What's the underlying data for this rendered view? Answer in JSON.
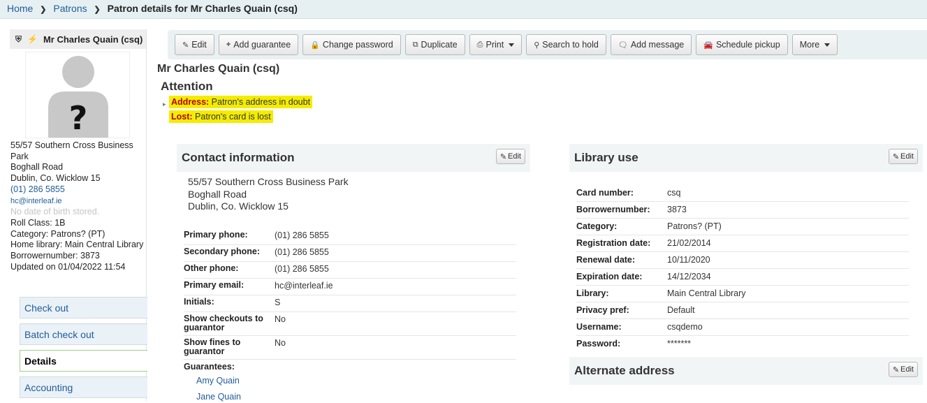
{
  "breadcrumb": {
    "home": "Home",
    "patrons": "Patrons",
    "current": "Patron details for Mr Charles Quain (csq)"
  },
  "sidebar": {
    "patron_name": "Mr Charles Quain (csq)",
    "icons": [
      "shield-icon",
      "flash-icon"
    ],
    "info": {
      "address1": "55/57 Southern Cross Business Park",
      "address2": "Boghall Road",
      "address3": "Dublin, Co. Wicklow 15",
      "phone": "(01) 286 5855",
      "email": "hc@interleaf.ie",
      "dob": "No date of birth stored.",
      "roll_class": "Roll Class: 1B",
      "category": "Category: Patrons? (PT)",
      "home_library": "Home library: Main Central Library",
      "borrowernumber": "Borrowernumber: 3873",
      "updated": "Updated on 01/04/2022 11:54"
    },
    "tabs": [
      {
        "label": "Check out"
      },
      {
        "label": "Batch check out"
      },
      {
        "label": "Details"
      },
      {
        "label": "Accounting"
      }
    ]
  },
  "toolbar": {
    "buttons": [
      {
        "label": "Edit",
        "icon": "pencil-icon"
      },
      {
        "label": "Add guarantee",
        "icon": "plus-icon"
      },
      {
        "label": "Change password",
        "icon": "lock-icon"
      },
      {
        "label": "Duplicate",
        "icon": "copy-icon"
      },
      {
        "label": "Print",
        "icon": "print-icon"
      },
      {
        "label": "Search to hold",
        "icon": "search-icon"
      },
      {
        "label": "Add message",
        "icon": "comment-icon"
      },
      {
        "label": "Schedule pickup",
        "icon": "car-icon"
      },
      {
        "label": "More"
      }
    ]
  },
  "main": {
    "patron_title": "Mr Charles Quain (csq)",
    "attention_title": "Attention",
    "alerts": [
      {
        "key": "Address:",
        "text": "Patron's address in doubt"
      },
      {
        "key": "Lost:",
        "text": "Patron's card is lost"
      }
    ],
    "alert_color": "#f4ec00"
  },
  "contact": {
    "title": "Contact information",
    "edit_label": "Edit",
    "address": [
      "55/57 Southern Cross Business Park",
      "Boghall Road",
      "Dublin, Co. Wicklow 15"
    ],
    "fields": [
      {
        "label": "Primary phone:",
        "value": "(01) 286 5855"
      },
      {
        "label": "Secondary phone:",
        "value": "(01) 286 5855"
      },
      {
        "label": "Other phone:",
        "value": "(01) 286 5855"
      },
      {
        "label": "Primary email:",
        "value": "hc@interleaf.ie"
      },
      {
        "label": "Initials:",
        "value": "S"
      },
      {
        "label": "Show checkouts to guarantor",
        "value": "No"
      },
      {
        "label": "Show fines to guarantor",
        "value": "No"
      }
    ],
    "guarantees_label": "Guarantees:",
    "guarantees": [
      "Amy Quain",
      "Jane Quain"
    ]
  },
  "library_use": {
    "title": "Library use",
    "edit_label": "Edit",
    "fields": [
      {
        "label": "Card number:",
        "value": "csq"
      },
      {
        "label": "Borrowernumber:",
        "value": "3873"
      },
      {
        "label": "Category:",
        "value": "Patrons? (PT)"
      },
      {
        "label": "Registration date:",
        "value": "21/02/2014"
      },
      {
        "label": "Renewal date:",
        "value": "10/11/2020"
      },
      {
        "label": "Expiration date:",
        "value": "14/12/2034"
      },
      {
        "label": "Library:",
        "value": "Main Central Library"
      },
      {
        "label": "Privacy pref:",
        "value": "Default"
      },
      {
        "label": "Username:",
        "value": "csqdemo"
      },
      {
        "label": "Password:",
        "value": "*******"
      }
    ]
  },
  "alternate": {
    "title": "Alternate address",
    "edit_label": "Edit"
  }
}
